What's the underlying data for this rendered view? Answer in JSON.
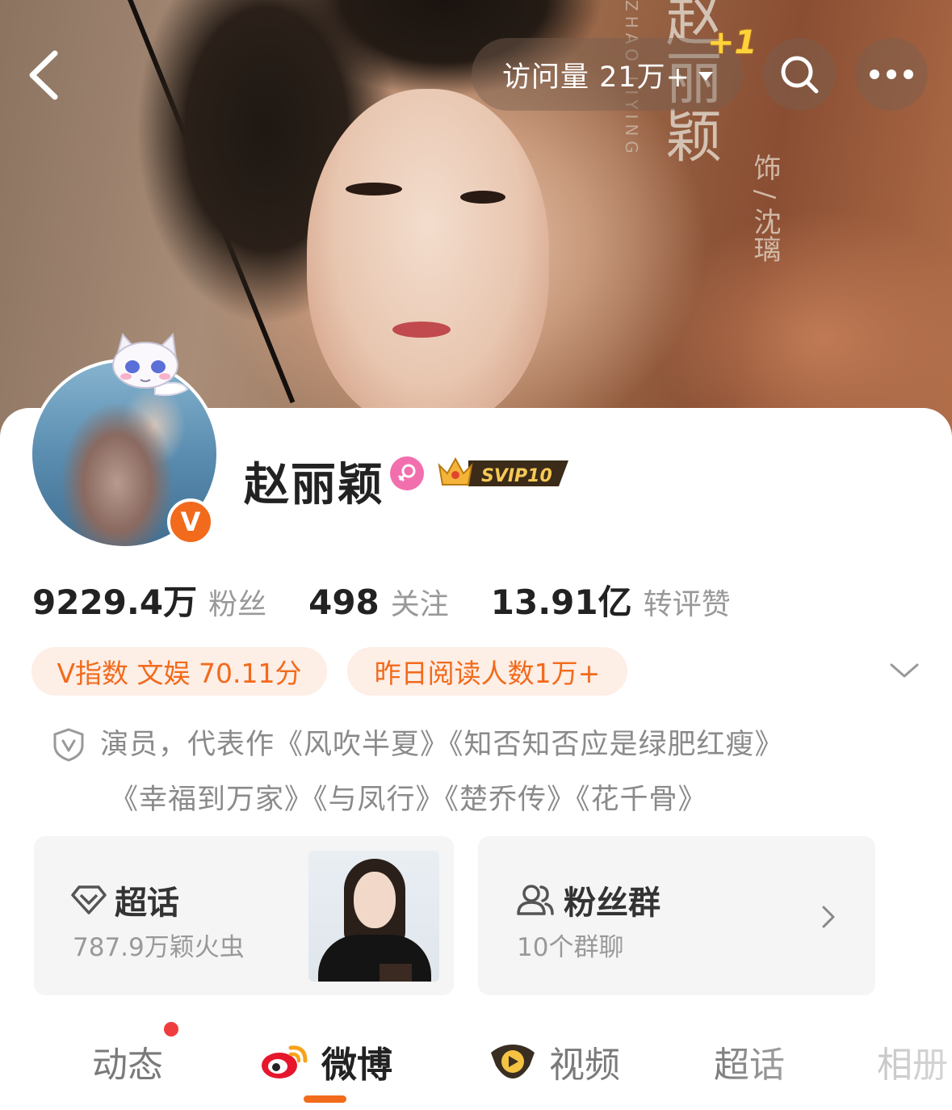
{
  "header": {
    "visits_text": "访问量 21万+",
    "visits_increment": "+1",
    "banner_title": "赵丽颖",
    "banner_subtitle": "饰 / 沈璃",
    "banner_pinyin": "ZHAO LIYING",
    "back_icon": "chevron-left-icon",
    "search_icon": "search-icon",
    "more_icon": "more-dots-icon"
  },
  "profile": {
    "name": "赵丽颖",
    "gender": "female",
    "vip_badge": "SVIP10",
    "verified_badge": "V",
    "brand_color": "#f26a1b"
  },
  "stats": [
    {
      "value": "9229.4万",
      "label": "粉丝"
    },
    {
      "value": "498",
      "label": "关注"
    },
    {
      "value": "13.91亿",
      "label": "转评赞"
    }
  ],
  "tags": [
    {
      "text": "V指数 文娱 70.11分"
    },
    {
      "text": "昨日阅读人数1万+"
    }
  ],
  "bio": {
    "line1": "演员，代表作《风吹半夏》《知否知否应是绿肥红瘦》",
    "line2": "《幸福到万家》《与凤行》《楚乔传》《花千骨》"
  },
  "panels": {
    "supertopic": {
      "title": "超话",
      "subtitle": "787.9万颖火虫"
    },
    "fan_group": {
      "title": "粉丝群",
      "subtitle": "10个群聊"
    }
  },
  "tabs": [
    {
      "label": "动态",
      "has_dot": true
    },
    {
      "label": "微博",
      "active": true
    },
    {
      "label": "视频"
    },
    {
      "label": "超话"
    },
    {
      "label": "相册"
    }
  ]
}
